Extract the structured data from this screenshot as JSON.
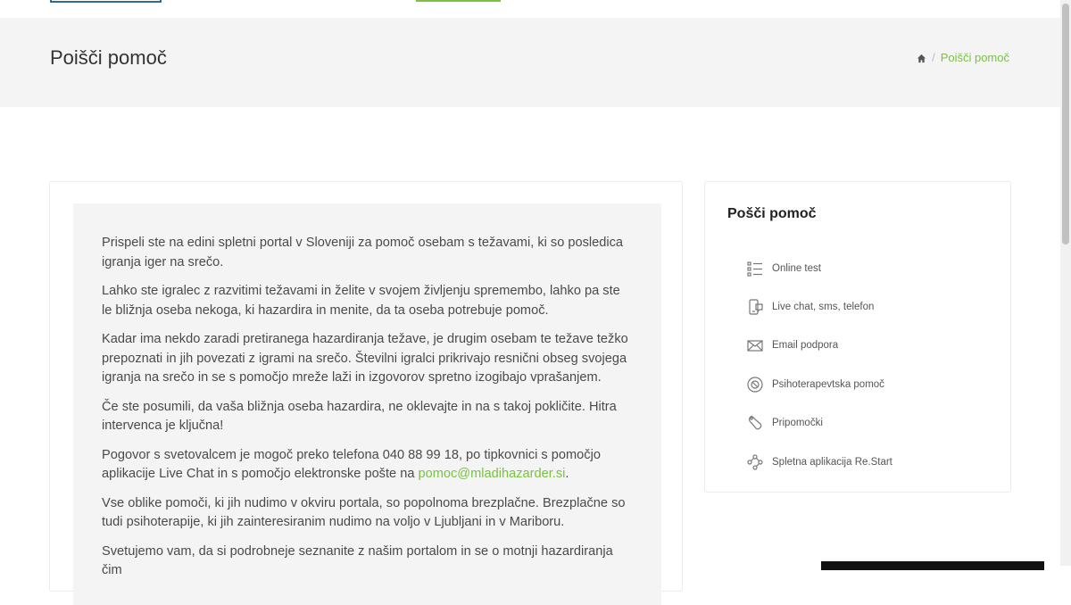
{
  "header": {
    "title": "Poišči pomoč",
    "breadcrumb": {
      "home_icon": "home-icon",
      "separator": "/",
      "current": "Poišči pomoč"
    }
  },
  "content": {
    "p1": "Prispeli ste na edini spletni portal v Sloveniji za pomoč osebam s težavami, ki so posledica igranja iger na srečo.",
    "p2": "Lahko ste igralec z razvitimi težavami in želite v svojem življenju spremembo, lahko pa ste le bližnja oseba nekoga, ki hazardira in menite, da ta oseba potrebuje pomoč.",
    "p3": "Kadar ima nekdo zaradi pretiranega hazardiranja težave, je drugim osebam te težave težko prepoznati in jih povezati z igrami na srečo. Številni igralci prikrivajo resnični obseg svojega igranja na srečo in se s pomočjo mreže laži in izgovorov spretno izogibajo vprašanjem.",
    "p4": "Če ste posumili, da vaša bližnja oseba hazardira, ne oklevajte in na s takoj pokličite. Hitra intervenca je ključna!",
    "p5_before": "Pogovor s svetovalcem je mogoč preko telefona 040 88 99 18, po tipkovnici s pomočjo aplikacije Live Chat in s pomočjo elektronske pošte na ",
    "p5_link": "pomoc@mladihazarder.si",
    "p5_after": ".",
    "p6": "Vse oblike pomoči, ki jih nudimo v okviru portala, so popolnoma brezplačne. Brezplačne so tudi psihoterapije, ki jih zainteresiranim nudimo na voljo v Ljubljani in v Mariboru.",
    "p7": "Svetujemo vam, da si podrobneje seznanite z našim portalom in se o motnji hazardiranja čim"
  },
  "sidebar": {
    "title": "Pošči pomoč",
    "items": [
      {
        "label": "Online test",
        "icon": "checklist-icon"
      },
      {
        "label": "Live chat, sms, telefon",
        "icon": "phone-chat-icon"
      },
      {
        "label": "Email podpora",
        "icon": "envelope-icon"
      },
      {
        "label": "Psihoterapevtska pomoč",
        "icon": "therapy-icon"
      },
      {
        "label": "Pripomočki",
        "icon": "hand-tool-icon"
      },
      {
        "label": "Spletna aplikacija Re.Start",
        "icon": "network-icon"
      }
    ]
  },
  "colors": {
    "accent": "#7ac143",
    "header_bg": "#f4f4f4",
    "text": "#4a4a4a"
  }
}
